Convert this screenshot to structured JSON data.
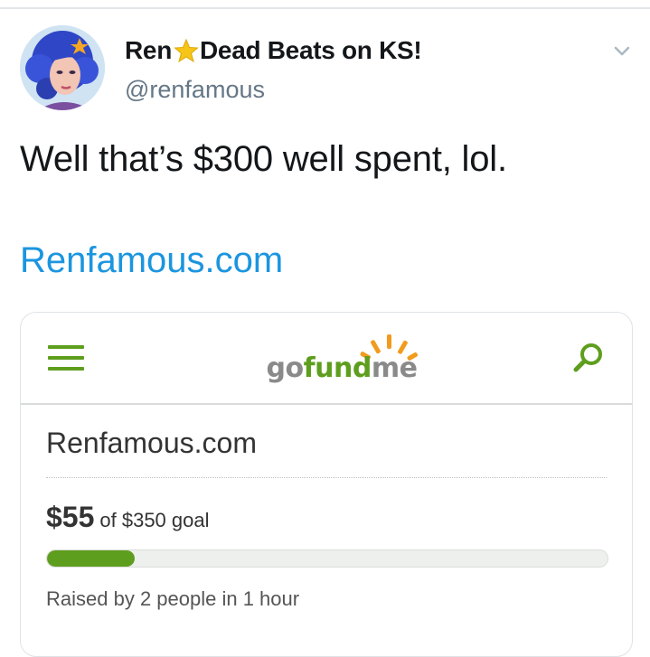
{
  "tweet": {
    "author_name_part1": "Ren",
    "author_name_part2": "Dead Beats on KS!",
    "handle": "@renfamous",
    "text": "Well that’s $300 well spent, lol.",
    "link_text": "Renfamous.com"
  },
  "card": {
    "logo_part1": "go",
    "logo_part2": "fund",
    "logo_part3": "me",
    "campaign_title": "Renfamous.com",
    "amount_raised": "$55",
    "goal_text": "of $350 goal",
    "progress_fraction": 0.157,
    "raised_by_text": "Raised by 2 people in 1 hour"
  },
  "icons": {
    "star": "star-icon",
    "chevron": "chevron-down-icon",
    "menu": "hamburger-menu-icon",
    "search": "search-icon"
  },
  "colors": {
    "link_blue": "#1b95e0",
    "gofundme_green": "#5e9e1e",
    "star_gold": "#f5c518",
    "logo_sun_orange": "#f29b1d"
  }
}
